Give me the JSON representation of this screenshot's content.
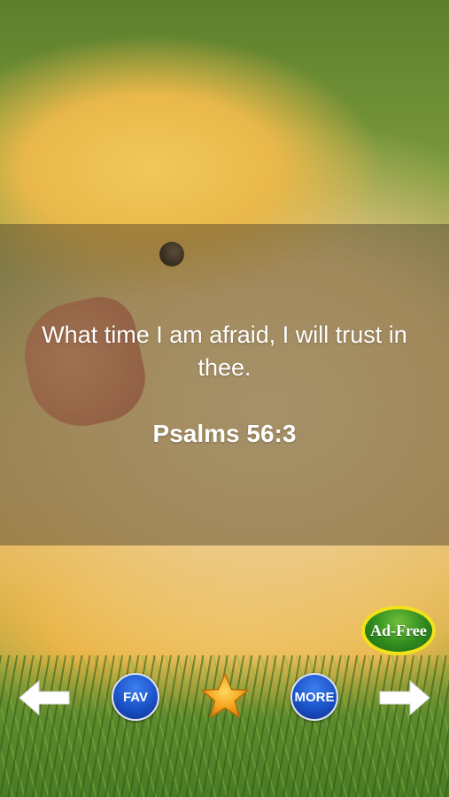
{
  "verse": {
    "text": "What time I am afraid, I will trust in thee.",
    "reference": "Psalms 56:3"
  },
  "badge": {
    "label": "Ad-Free"
  },
  "toolbar": {
    "prev_icon": "left-arrow-icon",
    "fav_label": "FAV",
    "favorite_icon": "star-icon",
    "more_label": "MORE",
    "next_icon": "right-arrow-icon"
  },
  "colors": {
    "button_blue": "#1a52c8",
    "star_gold": "#f5a623",
    "badge_green": "#2f8a1d",
    "badge_border": "#f2e21a"
  }
}
